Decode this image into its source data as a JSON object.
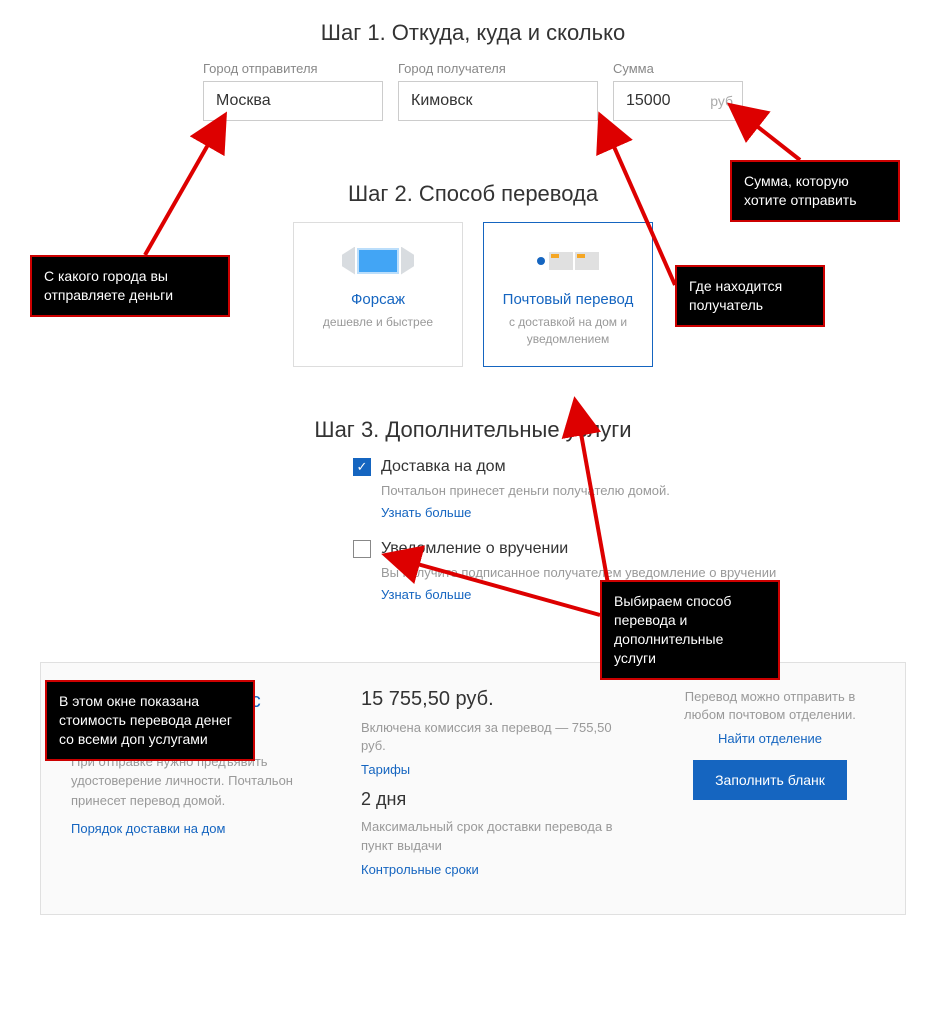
{
  "step1": {
    "title": "Шаг 1. Откуда, куда и сколько",
    "sender_label": "Город отправителя",
    "sender_value": "Москва",
    "receiver_label": "Город получателя",
    "receiver_value": "Кимовск",
    "amount_label": "Сумма",
    "amount_value": "15000",
    "amount_unit": "руб"
  },
  "step2": {
    "title": "Шаг 2. Способ перевода",
    "method1": {
      "title": "Форсаж",
      "sub": "дешевле и быстрее"
    },
    "method2": {
      "title": "Почтовый перевод",
      "sub": "с доставкой на дом и уведомлением"
    }
  },
  "step3": {
    "title": "Шаг 3. Дополнительные услуги",
    "opt1": {
      "label": "Доставка на дом",
      "desc": "Почтальон принесет деньги получателю домой.",
      "more": "Узнать больше"
    },
    "opt2": {
      "label": "Уведомление о вручении",
      "desc": "Вы получите подписанное получателем уведомление о вручении",
      "more": "Узнать больше"
    }
  },
  "summary": {
    "title": "Почтовый перевод с доставкой на дом",
    "text": "При отправке нужно предъявить удостоверение личности. Почтальон принесет перевод домой.",
    "link1": "Порядок доставки на дом",
    "price": "15 755,50 руб.",
    "commission": "Включена комиссия за перевод — 755,50  руб.",
    "tariffs": "Тарифы",
    "days": "2 дня",
    "days_desc": "Максимальный срок доставки перевода в пункт выдачи",
    "deadlines": "Контрольные сроки",
    "side_text": "Перевод можно отправить в любом почтовом отделении.",
    "find_office": "Найти отделение",
    "button": "Заполнить бланк"
  },
  "callouts": {
    "c1": "С какого города вы отправляете деньги",
    "c2": "Сумма, которую хотите отправить",
    "c3": "Где находится получатель",
    "c4": "Выбираем способ перевода и дополнительные услуги",
    "c5": "В этом окне показана стоимость перевода денег со всеми доп услугами"
  }
}
